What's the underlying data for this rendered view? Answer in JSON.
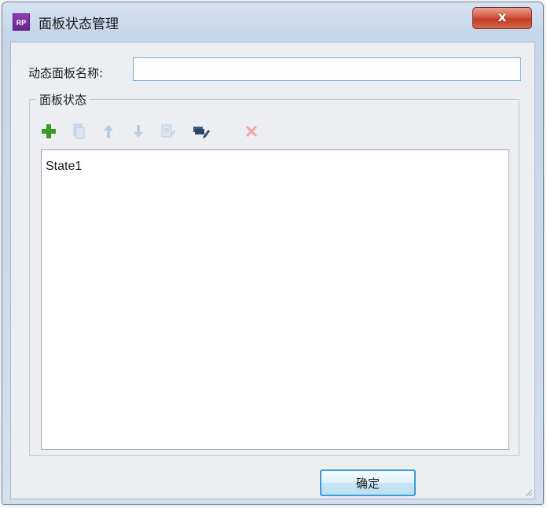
{
  "window": {
    "title": "面板状态管理",
    "app_icon_text": "RP",
    "close_glyph": "x"
  },
  "form": {
    "name_label": "动态面板名称:",
    "name_value": "",
    "name_placeholder": ""
  },
  "group": {
    "title": "面板状态",
    "toolbar": [
      {
        "icon": "add-icon",
        "enabled": true
      },
      {
        "icon": "duplicate-icon",
        "enabled": false
      },
      {
        "icon": "move-up-icon",
        "enabled": false
      },
      {
        "icon": "move-down-icon",
        "enabled": false
      },
      {
        "icon": "edit-state-icon",
        "enabled": false
      },
      {
        "icon": "edit-all-states-icon",
        "enabled": true
      },
      {
        "icon": "delete-icon",
        "enabled": false
      }
    ],
    "states": [
      "State1"
    ]
  },
  "buttons": {
    "ok_label": "确定"
  },
  "colors": {
    "add_green": "#3a9a2a",
    "disabled_blue": "#b9cde4",
    "delete_red": "#f2a6a6",
    "focus_border": "#3c9ed4"
  }
}
